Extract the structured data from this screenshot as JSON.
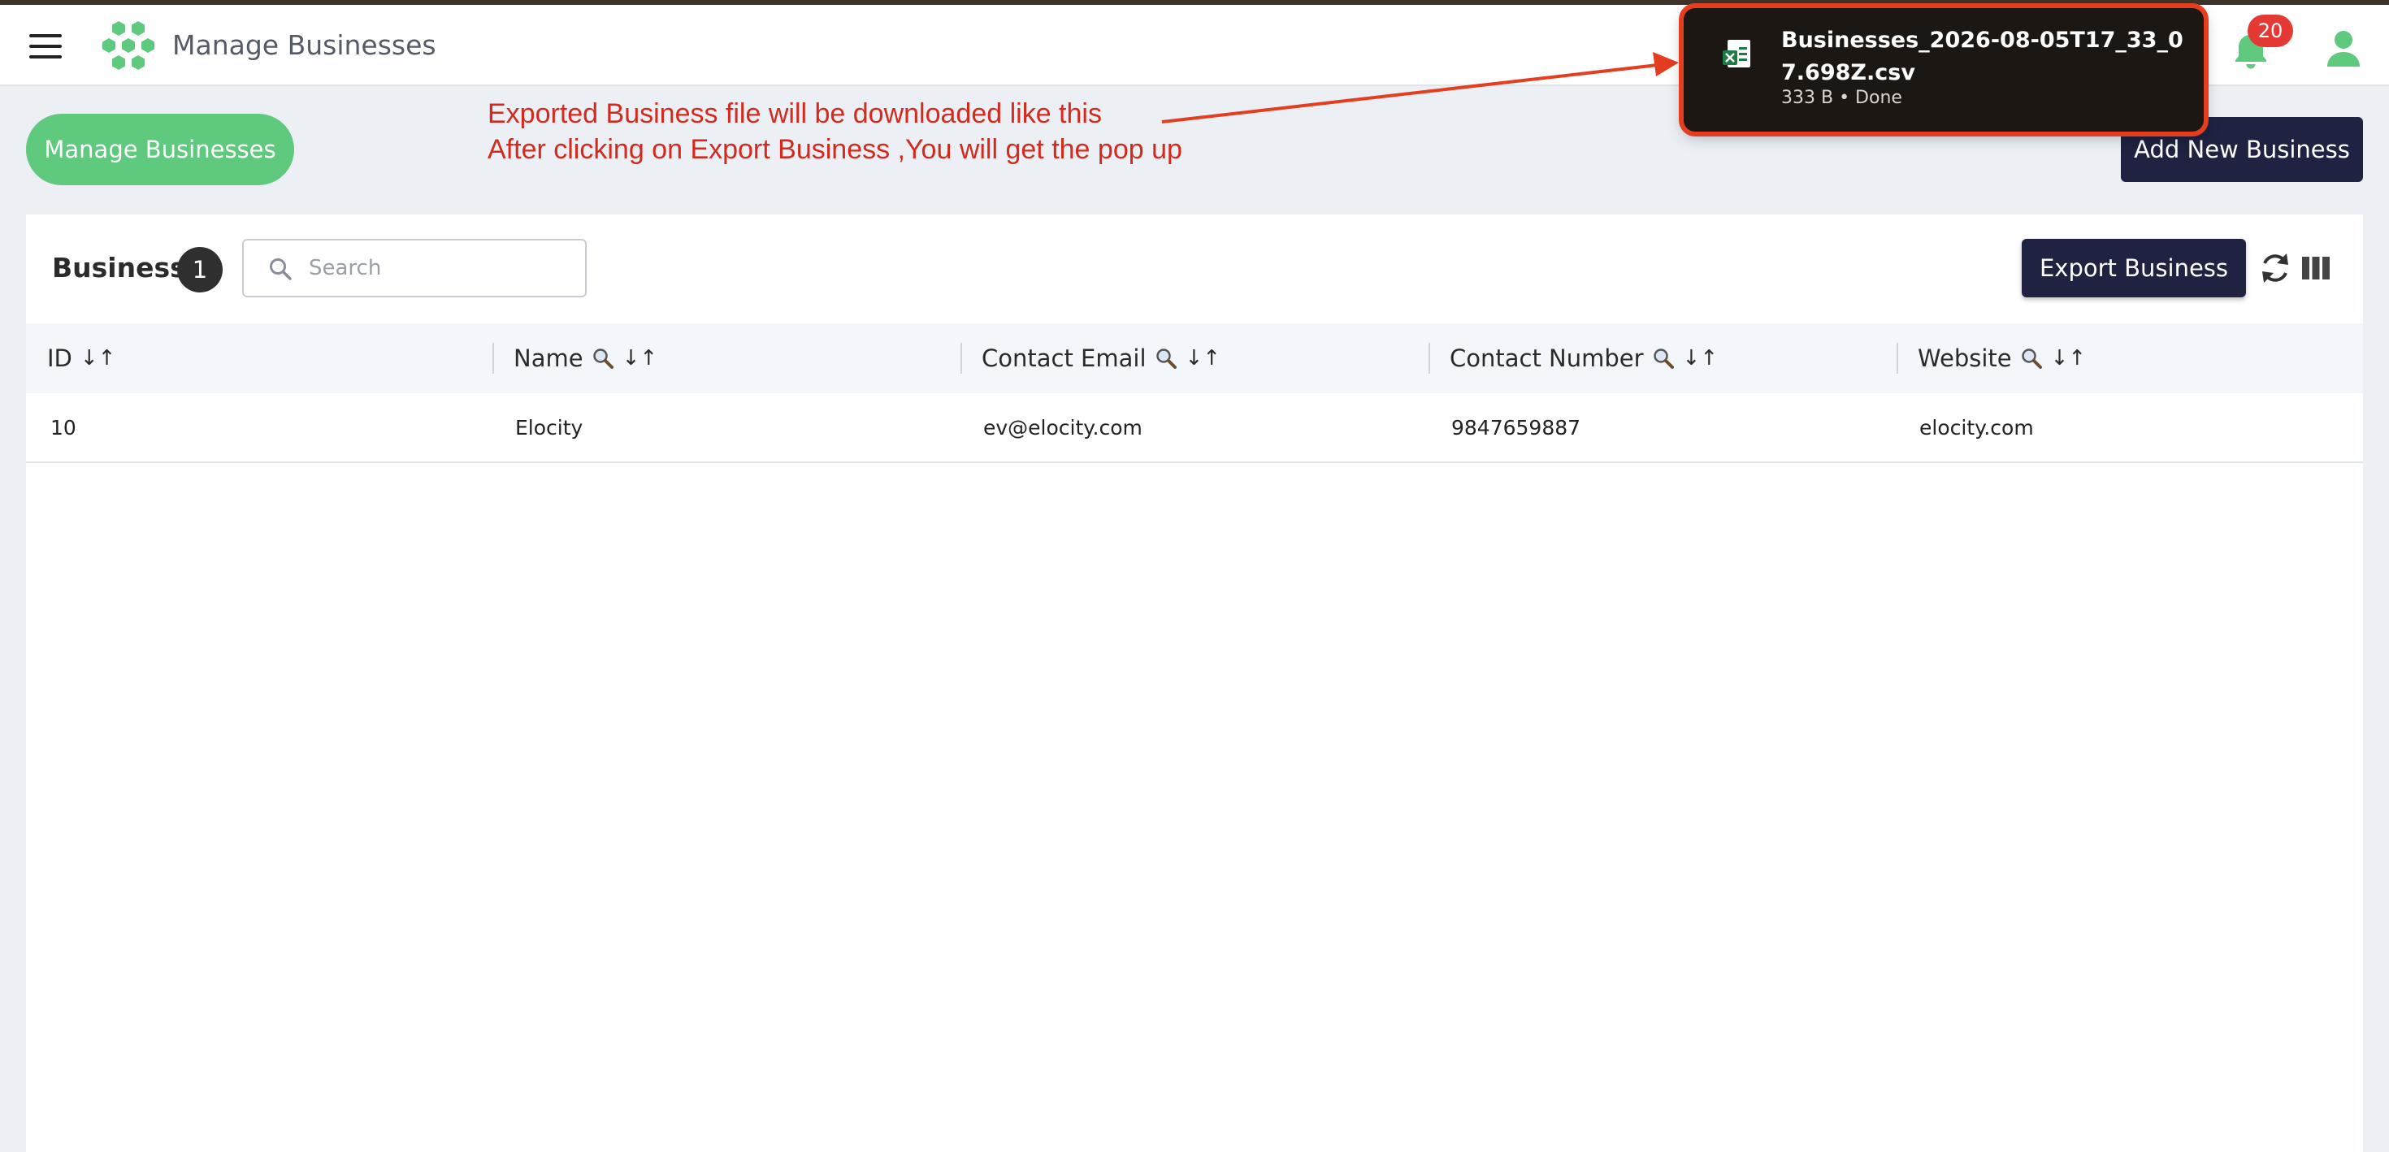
{
  "header": {
    "title": "Manage Businesses",
    "notifications_count": "20"
  },
  "page": {
    "manage_pill_label": "Manage Businesses",
    "add_new_label": "Add New Business"
  },
  "annotation": {
    "line1": "Exported Business file will be downloaded like this",
    "line2": "After clicking on Export Business ,You will get the pop up",
    "color": "#d42a1e"
  },
  "download": {
    "file_name": "Businesses_2026-08-05T17_33_07.698Z.csv",
    "meta": "333 B • Done"
  },
  "card": {
    "title": "Business",
    "count": "1",
    "search_placeholder": "Search",
    "export_label": "Export Business"
  },
  "table": {
    "columns": [
      {
        "label": "ID",
        "sort": "↓↑"
      },
      {
        "label": "Name",
        "sort": "↓↑"
      },
      {
        "label": "Contact Email",
        "sort": "↓↑"
      },
      {
        "label": "Contact Number",
        "sort": "↓↑"
      },
      {
        "label": "Website",
        "sort": "↓↑"
      }
    ],
    "rows": [
      [
        "10",
        "Elocity",
        "ev@elocity.com",
        "9847659887",
        "elocity.com"
      ]
    ]
  },
  "colors": {
    "brand_green": "#5fc97e",
    "navy": "#1f2240",
    "badge_red": "#e53935",
    "annotation_red": "#e53d1f"
  },
  "icons": [
    "menu-icon",
    "logo-icon",
    "bell-icon",
    "user-icon",
    "search-icon",
    "refresh-icon",
    "columns-icon",
    "magnifier-icon",
    "sort-icon",
    "csv-file-icon"
  ]
}
